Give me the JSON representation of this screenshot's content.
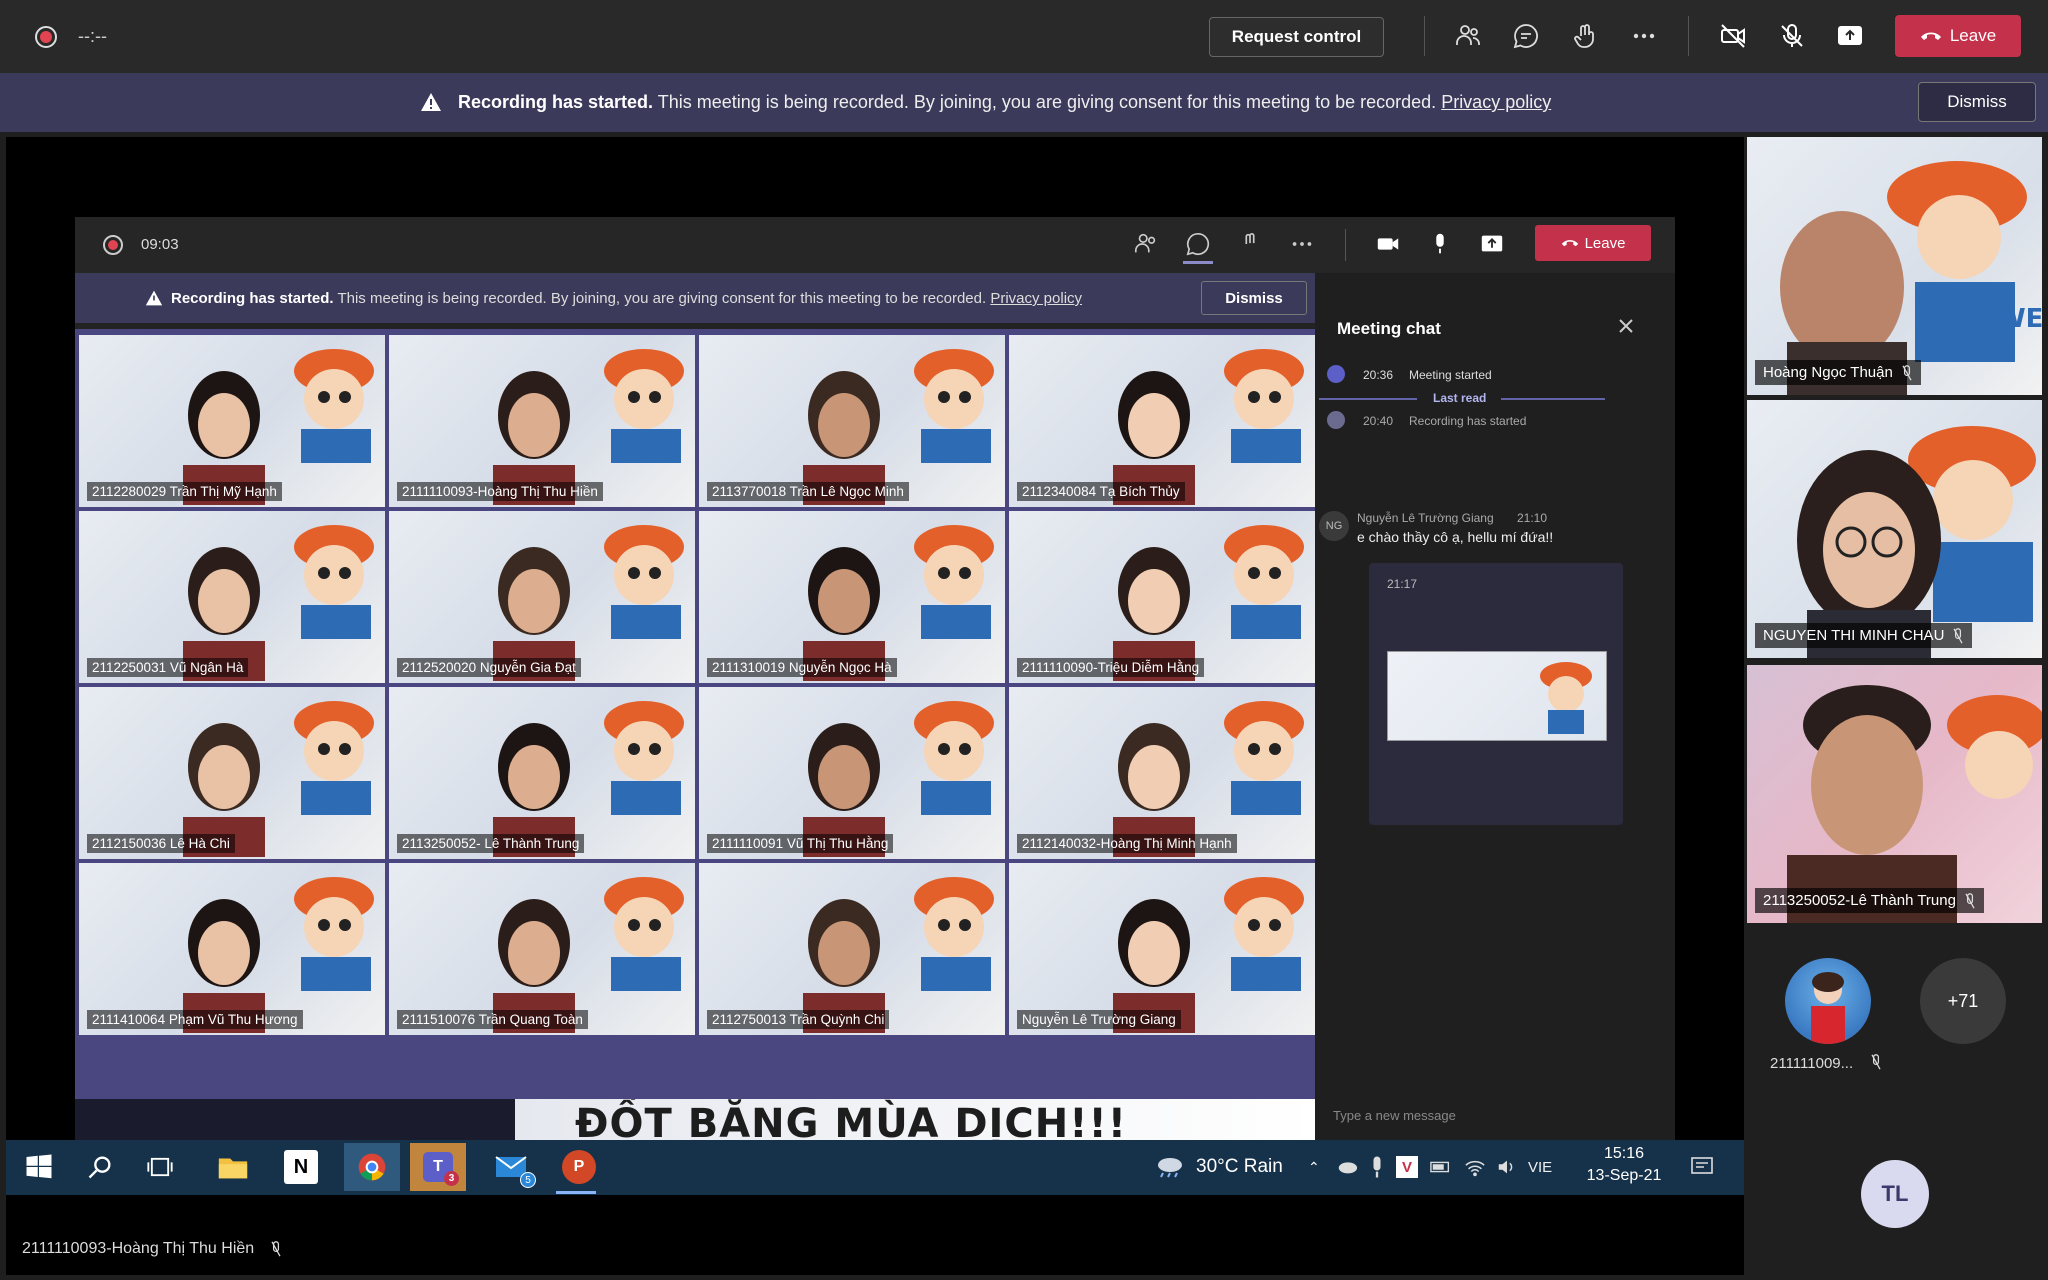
{
  "topbar": {
    "timer": "--:--",
    "request_control": "Request control",
    "leave_label": "Leave",
    "icons": [
      "people-icon",
      "chat-icon",
      "reactions-icon",
      "more-icon",
      "camera-off-icon",
      "mic-off-icon",
      "share-icon"
    ]
  },
  "banner": {
    "title": "Recording has started.",
    "message": "This meeting is being recorded. By joining, you are giving consent for this meeting to be recorded.",
    "privacy": "Privacy policy",
    "dismiss": "Dismiss"
  },
  "shared": {
    "timer": "09:03",
    "leave_label": "Leave",
    "banner_title": "Recording has started.",
    "banner_message": "This meeting is being recorded. By joining, you are giving consent for this meeting to be recorded.",
    "banner_privacy": "Privacy policy",
    "banner_dismiss": "Dismiss",
    "grid": [
      "2112280029 Trần Thị Mỹ Hạnh",
      "2111110093-Hoàng Thị Thu Hiền",
      "2113770018 Trần Lê Ngọc Minh",
      "2112340084 Tạ Bích Thủy",
      "2112250031 Vũ Ngân Hà",
      "2112520020 Nguyễn Gia Đạt",
      "2111310019 Nguyễn Ngọc Hà",
      "2111110090-Triệu Diễm Hằng",
      "2112150036 Lê Hà Chi",
      "2113250052- Lê Thành Trung",
      "2111110091 Vũ Thị Thu Hằng",
      "2112140032-Hoàng Thị Minh Hạnh",
      "2111410064 Phạm Vũ Thu Hương",
      "2111510076 Trần Quang Toàn",
      "2112750013 Trần Quỳnh Chi",
      "Nguyễn Lê Trường Giang"
    ],
    "slide_title": "ĐỐT BĂNG MÙA DỊCH!!!",
    "chat": {
      "title": "Meeting chat",
      "events": [
        {
          "time": "20:36",
          "text": "Meeting started"
        },
        {
          "time": "20:40",
          "text": "Recording has started"
        }
      ],
      "last_read": "Last read",
      "message_author": "Nguyễn Lê Trường Giang",
      "message_time": "21:10",
      "message_avatar": "NG",
      "message_text": "e chào thầy cô ạ, hellu mí đứa!!",
      "image_time": "21:17",
      "input_placeholder": "Type a new message"
    },
    "taskbar": {
      "weather": "30°C  Rain",
      "lang": "VIE",
      "time": "15:16",
      "date": "13-Sep-21",
      "teams_badge": "3",
      "mail_badge": "5"
    }
  },
  "sidebar": {
    "participants": [
      {
        "name": "Hoàng Ngọc Thuận"
      },
      {
        "name": "NGUYEN THI MINH CHAU"
      },
      {
        "name": "2113250052-Lê Thành Trung"
      }
    ],
    "small_avatar_name": "211111009...",
    "more_count": "+71",
    "self_initials": "TL"
  },
  "presenter_name": "2111110093-Hoàng Thị Thu Hiền",
  "colors": {
    "leave": "#c4314b",
    "banner": "#3b3a5a",
    "accent": "#6264a7"
  }
}
